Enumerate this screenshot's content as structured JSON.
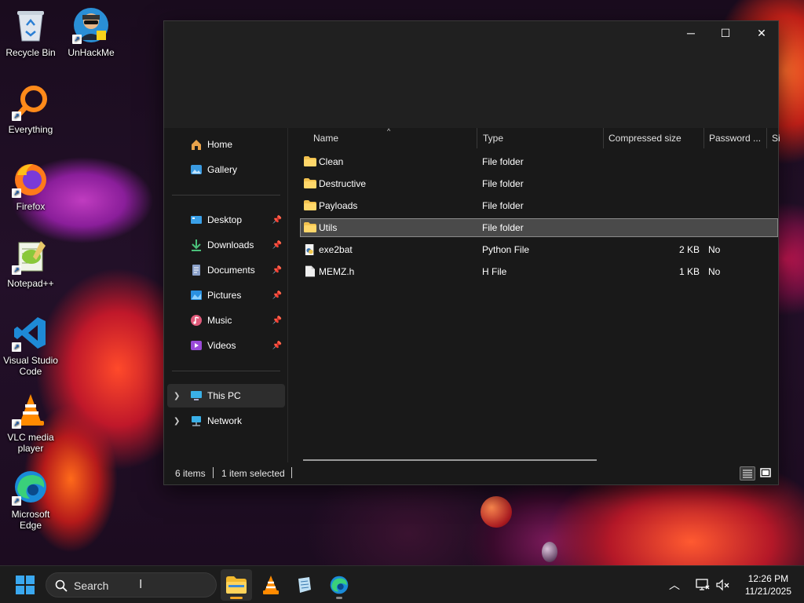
{
  "desktop": {
    "icons": [
      {
        "label": "Recycle Bin"
      },
      {
        "label": "UnHackMe"
      },
      {
        "label": "Everything"
      },
      {
        "label": "Firefox"
      },
      {
        "label": "Notepad++"
      },
      {
        "label": "Visual Studio Code"
      },
      {
        "label": "VLC media player"
      },
      {
        "label": "Microsoft Edge"
      }
    ]
  },
  "window": {
    "controls": {
      "minimize": "─",
      "maximize": "☐",
      "close": "✕"
    },
    "nav": {
      "items": [
        {
          "label": "Home",
          "icon": "home-icon"
        },
        {
          "label": "Gallery",
          "icon": "gallery-icon"
        },
        {
          "label": "Desktop",
          "icon": "desktop-icon",
          "pinned": true
        },
        {
          "label": "Downloads",
          "icon": "downloads-icon",
          "pinned": true
        },
        {
          "label": "Documents",
          "icon": "documents-icon",
          "pinned": true
        },
        {
          "label": "Pictures",
          "icon": "pictures-icon",
          "pinned": true
        },
        {
          "label": "Music",
          "icon": "music-icon",
          "pinned": true
        },
        {
          "label": "Videos",
          "icon": "videos-icon",
          "pinned": true
        },
        {
          "label": "This PC",
          "icon": "this-pc-icon",
          "selected": true
        },
        {
          "label": "Network",
          "icon": "network-icon"
        }
      ]
    },
    "columns": [
      "Name",
      "Type",
      "Compressed size",
      "Password ...",
      "Si"
    ],
    "files": [
      {
        "name": "Clean",
        "type": "File folder",
        "size": "",
        "password": "",
        "kind": "folder"
      },
      {
        "name": "Destructive",
        "type": "File folder",
        "size": "",
        "password": "",
        "kind": "folder"
      },
      {
        "name": "Payloads",
        "type": "File folder",
        "size": "",
        "password": "",
        "kind": "folder"
      },
      {
        "name": "Utils",
        "type": "File folder",
        "size": "",
        "password": "",
        "kind": "folder",
        "selected": true
      },
      {
        "name": "exe2bat",
        "type": "Python File",
        "size": "2 KB",
        "password": "No",
        "kind": "python"
      },
      {
        "name": "MEMZ.h",
        "type": "H File",
        "size": "1 KB",
        "password": "No",
        "kind": "file"
      }
    ],
    "status": {
      "count": "6 items",
      "selection": "1 item selected"
    }
  },
  "taskbar": {
    "search_placeholder": "Search",
    "clock_time": "12:26 PM",
    "clock_date": "11/21/2025",
    "apps": [
      "file-explorer-icon",
      "vlc-icon",
      "notepad-icon",
      "edge-icon"
    ]
  },
  "colors": {
    "folder": "#f2c14e",
    "accent": "#f5a623",
    "selection": "#4a4a4a"
  }
}
